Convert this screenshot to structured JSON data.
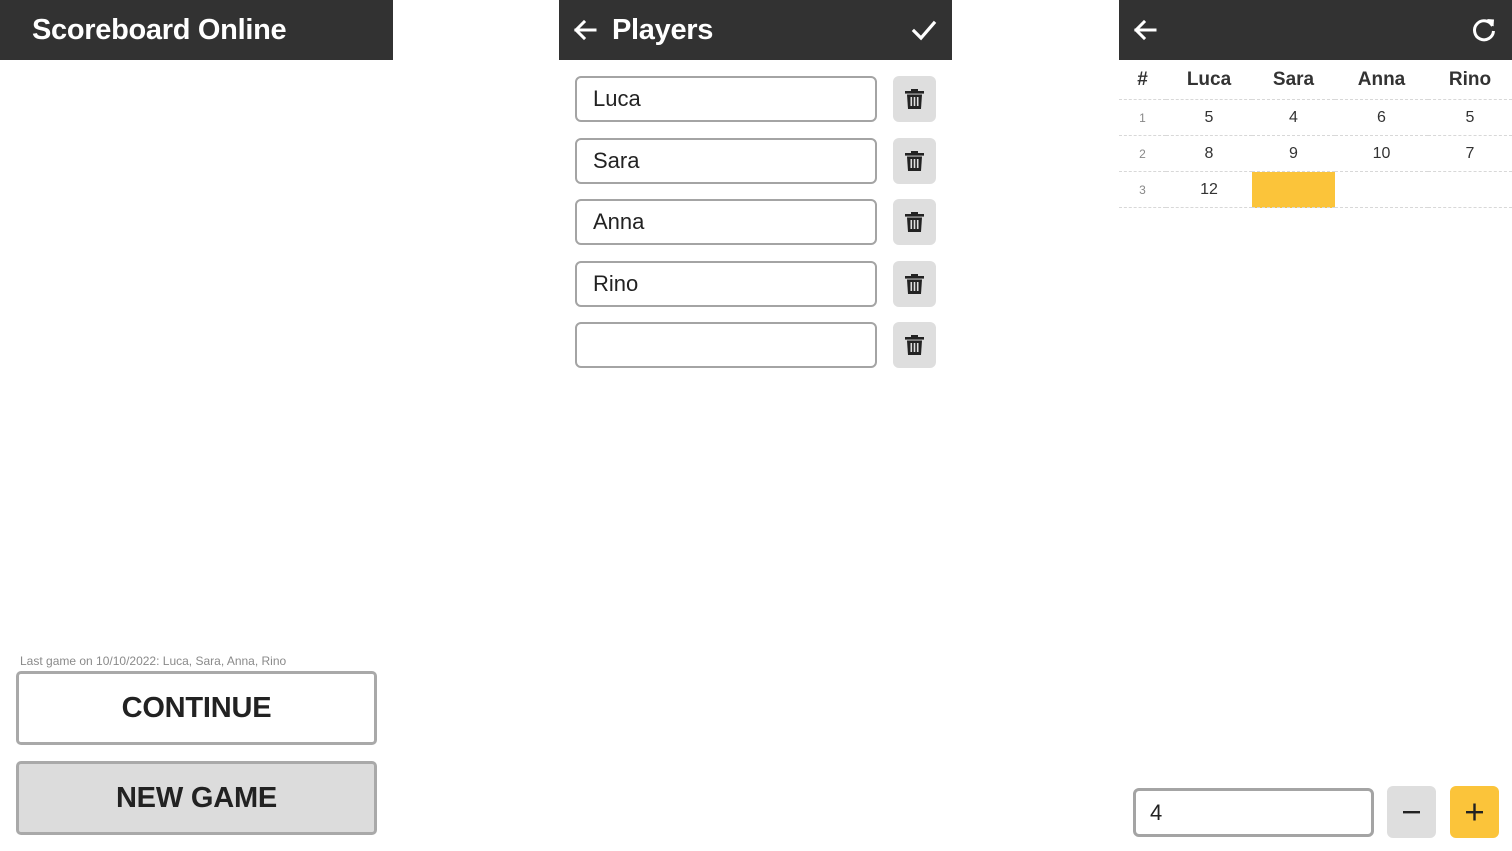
{
  "home": {
    "title": "Scoreboard Online",
    "last_game": "Last game on 10/10/2022: Luca, Sara, Anna, Rino",
    "continue_label": "CONTINUE",
    "new_game_label": "NEW GAME",
    "icons": {}
  },
  "players": {
    "title": "Players",
    "icons": {
      "back": "arrow-left-icon",
      "confirm": "check-icon",
      "delete": "trash-icon"
    },
    "names": [
      "Luca",
      "Sara",
      "Anna",
      "Rino",
      ""
    ]
  },
  "scoreboard": {
    "icons": {
      "back": "arrow-left-icon",
      "reset": "refresh-icon",
      "minus": "minus-icon",
      "plus": "plus-icon"
    },
    "round_header": "#",
    "players": [
      "Luca",
      "Sara",
      "Anna",
      "Rino"
    ],
    "rows": [
      {
        "round": "1",
        "scores": [
          "5",
          "4",
          "6",
          "5"
        ]
      },
      {
        "round": "2",
        "scores": [
          "8",
          "9",
          "10",
          "7"
        ]
      },
      {
        "round": "3",
        "scores": [
          "12",
          "",
          "",
          ""
        ]
      }
    ],
    "active_cell": {
      "round": 3,
      "player": "Sara"
    },
    "entry_value": "4"
  },
  "colors": {
    "appbar": "#323232",
    "accent": "#fbc43a",
    "button_gray": "#dcdcdc",
    "border_gray": "#a9a9a9"
  }
}
